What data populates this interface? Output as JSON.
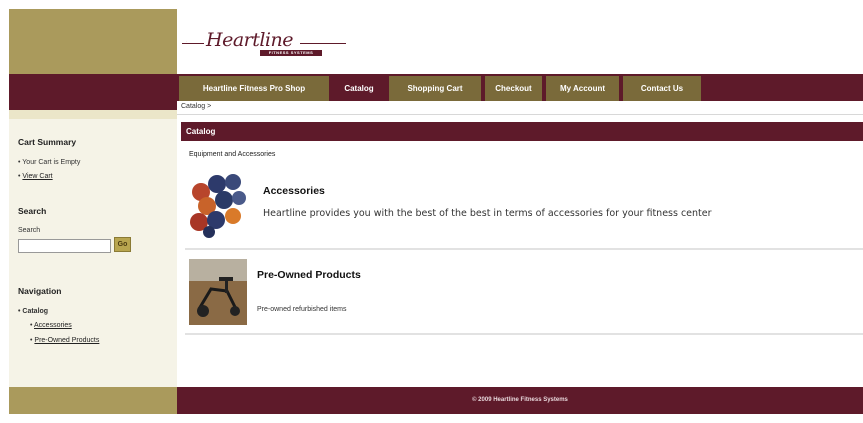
{
  "logo": {
    "script_text": "Heartline",
    "subtitle": "FITNESS SYSTEMS"
  },
  "nav": {
    "tabs": [
      {
        "label": "Heartline Fitness Pro Shop"
      },
      {
        "label": "Catalog"
      },
      {
        "label": "Shopping Cart"
      },
      {
        "label": "Checkout"
      },
      {
        "label": "My Account"
      },
      {
        "label": "Contact Us"
      }
    ]
  },
  "breadcrumb": "Catalog >",
  "sidebar": {
    "cart_title": "Cart Summary",
    "cart_empty": "Your Cart is Empty",
    "view_cart": "View Cart",
    "search_title": "Search",
    "search_label": "Search",
    "search_value": "",
    "go_label": "Go",
    "navigation_title": "Navigation",
    "catalog": "Catalog",
    "sub_items": [
      {
        "label": "Accessories"
      },
      {
        "label": "Pre-Owned Products"
      }
    ]
  },
  "main": {
    "section_title": "Catalog",
    "section_desc": "Equipment and Accessories",
    "items": [
      {
        "title": "Accessories",
        "desc": "Heartline provides you with the best of the best in terms of accessories for your fitness center"
      },
      {
        "title": "Pre-Owned Products",
        "desc": "Pre-owned refurbished items"
      }
    ]
  },
  "footer": {
    "copyright": "© 2009 Heartline Fitness Systems"
  },
  "colors": {
    "maroon": "#5e1a2a",
    "gold": "#aa9a5c",
    "tab_gold": "#7a6a3a",
    "sidebar_bg": "#f5f3e7"
  }
}
